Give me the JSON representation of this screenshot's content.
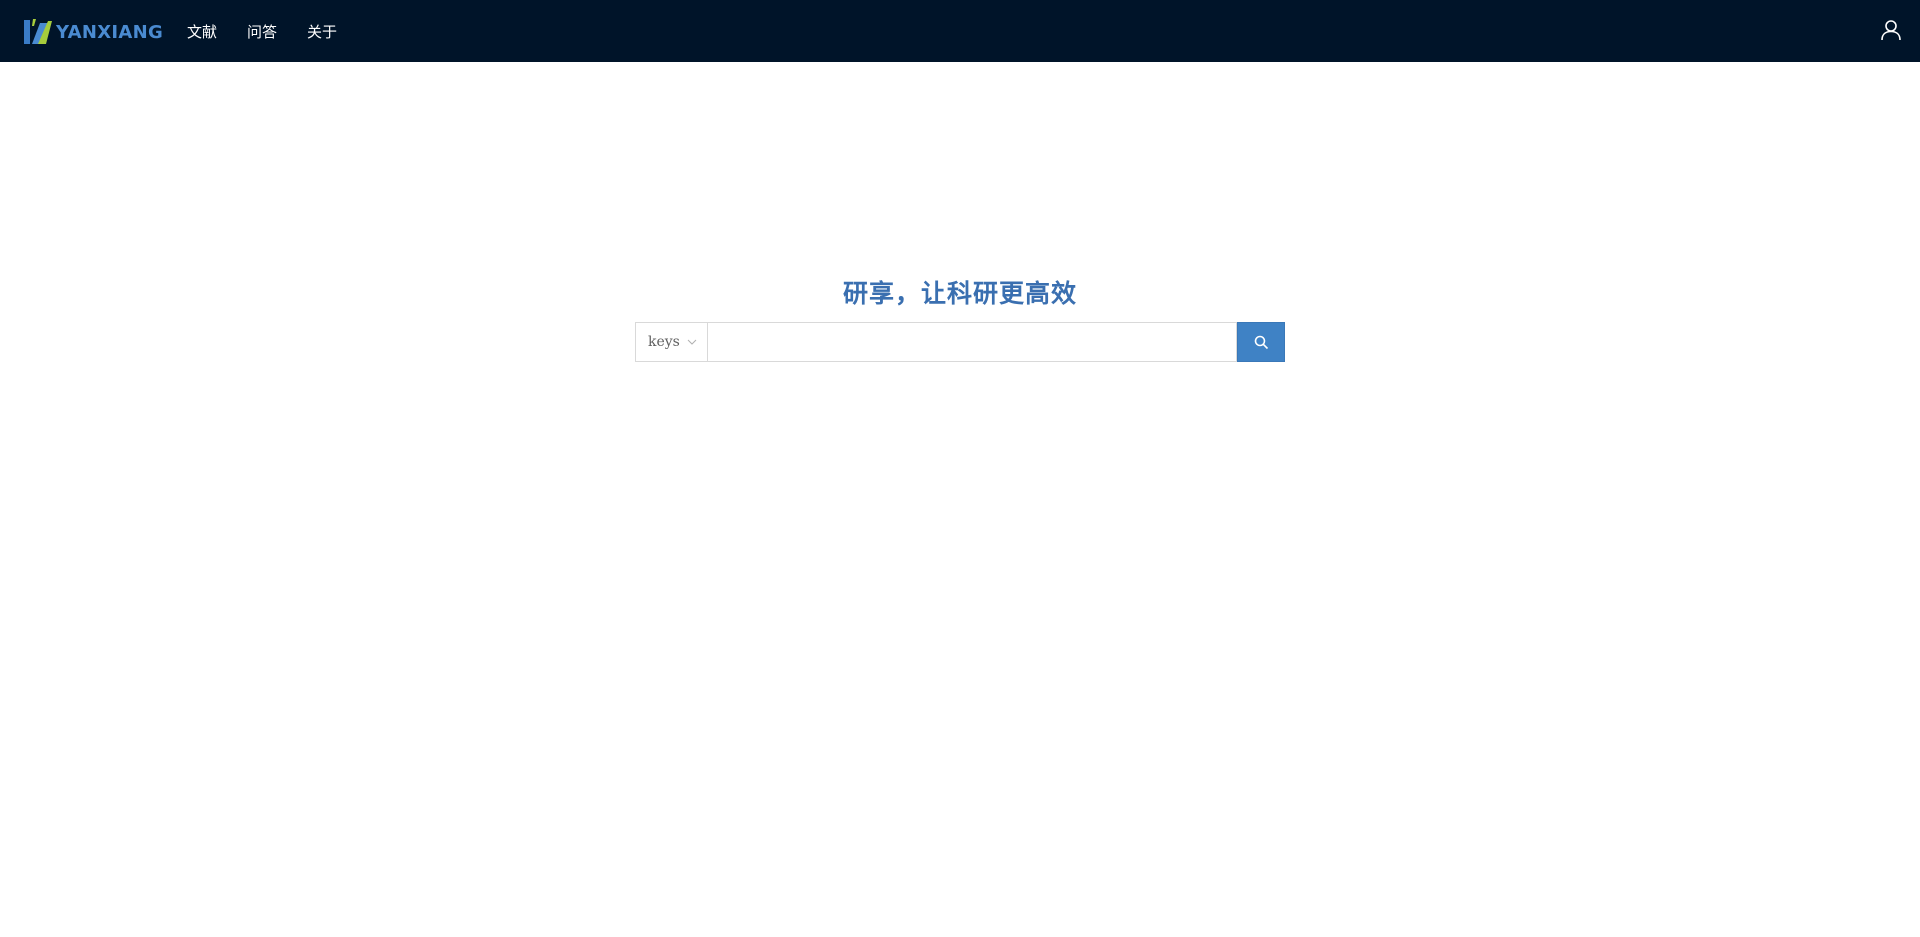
{
  "header": {
    "logo_text": "YANXIANG",
    "nav": [
      {
        "label": "文献"
      },
      {
        "label": "问答"
      },
      {
        "label": "关于"
      }
    ],
    "user_icon": "user-icon"
  },
  "hero": {
    "slogan": "研享，让科研更高效"
  },
  "search": {
    "type_selected": "keys",
    "input_value": "",
    "input_placeholder": "",
    "button_icon": "search-icon"
  },
  "colors": {
    "navbar_bg": "#001429",
    "logo_text": "#4a8bd1",
    "accent": "#3f82c5",
    "slogan": "#3a6fb0"
  }
}
